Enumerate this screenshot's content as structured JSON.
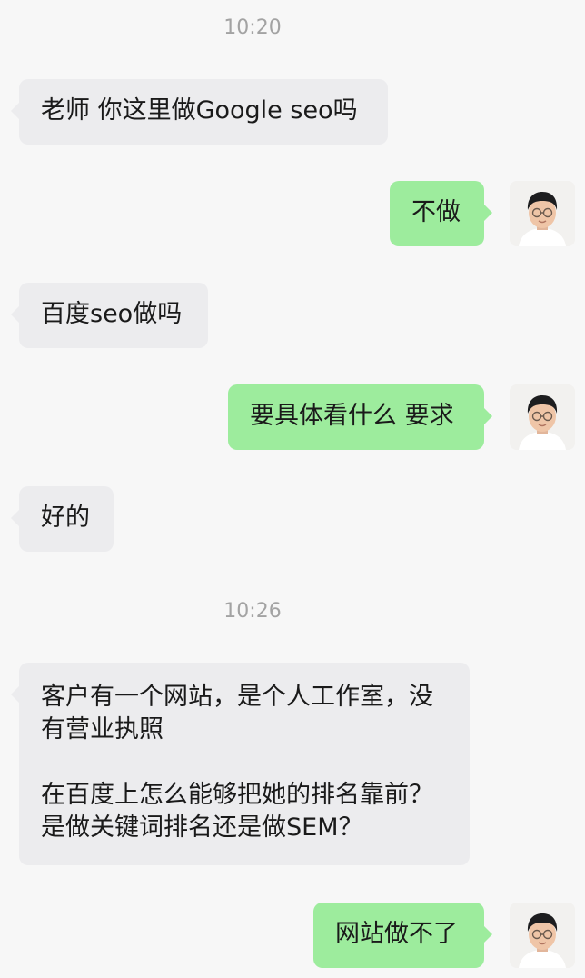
{
  "timestamps": [
    "10:20",
    "10:26"
  ],
  "messages": [
    {
      "side": "in",
      "text": "老师 你这里做Google seo吗"
    },
    {
      "side": "out",
      "text": "不做"
    },
    {
      "side": "in",
      "text": "百度seo做吗"
    },
    {
      "side": "out",
      "text": "要具体看什么 要求"
    },
    {
      "side": "in",
      "text": "好的"
    },
    {
      "side": "in",
      "text": "客户有一个网站，是个人工作室，没有营业执照\n\n在百度上怎么能够把她的排名靠前？是做关键词排名还是做SEM？"
    },
    {
      "side": "out",
      "text": "网站做不了"
    }
  ],
  "colors": {
    "background": "#f7f7f7",
    "incoming_bubble": "#ececee",
    "outgoing_bubble": "#9dec9d",
    "timestamp": "#a3a3a3"
  },
  "icons": {
    "sender_avatar": "user-avatar-icon"
  }
}
